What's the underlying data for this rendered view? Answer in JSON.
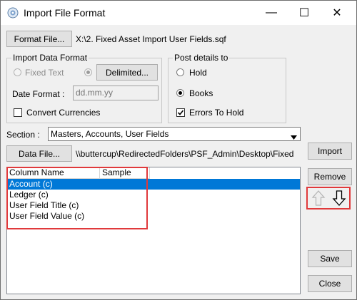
{
  "window": {
    "title": "Import File Format",
    "minimize_glyph": "—",
    "maximize_glyph": "☐",
    "close_glyph": "✕"
  },
  "format_file": {
    "button_label": "Format File...",
    "path": "X:\\2. Fixed Asset Import User Fields.sqf"
  },
  "import_data_format": {
    "group_label": "Import Data Format",
    "fixed_text_label": "Fixed Text",
    "delimited_label": "Delimited...",
    "date_format_label": "Date Format :",
    "date_format_value": "dd.mm.yy",
    "convert_currencies_label": "Convert Currencies",
    "convert_currencies_checked": false
  },
  "post_details": {
    "group_label": "Post details to",
    "hold_label": "Hold",
    "books_label": "Books",
    "selected": "Books",
    "errors_to_hold_label": "Errors To Hold",
    "errors_to_hold_checked": true
  },
  "section": {
    "label": "Section :",
    "value": "Masters, Accounts, User Fields"
  },
  "data_file": {
    "button_label": "Data File...",
    "path": "\\\\buttercup\\RedirectedFolders\\PSF_Admin\\Desktop\\Fixed"
  },
  "list": {
    "columns": [
      "Column Name",
      "Sample"
    ],
    "rows": [
      {
        "name": "Account (c)",
        "selected": true
      },
      {
        "name": "Ledger (c)",
        "selected": false
      },
      {
        "name": "User Field Title (c)",
        "selected": false
      },
      {
        "name": "User Field Value (c)",
        "selected": false
      }
    ]
  },
  "actions": {
    "import_label": "Import",
    "remove_label": "Remove",
    "up_icon": "arrow-up-icon",
    "down_icon": "arrow-down-icon",
    "save_label": "Save",
    "close_label": "Close"
  },
  "colors": {
    "selection": "#0078d7",
    "highlight_box": "#e0393b",
    "dialog_bg": "#f0f0f0"
  }
}
